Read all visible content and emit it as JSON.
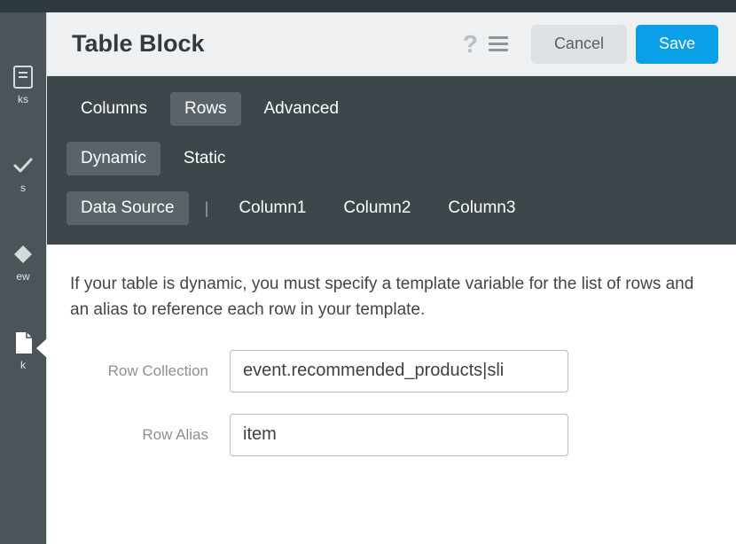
{
  "header": {
    "title": "Table Block",
    "cancel_label": "Cancel",
    "save_label": "Save"
  },
  "sidebar": {
    "items": [
      {
        "label": "ks"
      },
      {
        "label": "s"
      },
      {
        "label": "ew"
      },
      {
        "label": "k"
      }
    ]
  },
  "tabs": {
    "primary": [
      {
        "label": "Columns",
        "selected": false
      },
      {
        "label": "Rows",
        "selected": true
      },
      {
        "label": "Advanced",
        "selected": false
      }
    ],
    "secondary": [
      {
        "label": "Dynamic",
        "selected": true
      },
      {
        "label": "Static",
        "selected": false
      }
    ],
    "tertiary": [
      {
        "label": "Data Source",
        "selected": true
      },
      {
        "label": "Column1",
        "selected": false
      },
      {
        "label": "Column2",
        "selected": false
      },
      {
        "label": "Column3",
        "selected": false
      }
    ]
  },
  "content": {
    "description": "If your table is dynamic, you must specify a template variable for the list of rows and an alias to reference each row in your template.",
    "row_collection_label": "Row Collection",
    "row_collection_value": "event.recommended_products|sli",
    "row_alias_label": "Row Alias",
    "row_alias_value": "item"
  }
}
